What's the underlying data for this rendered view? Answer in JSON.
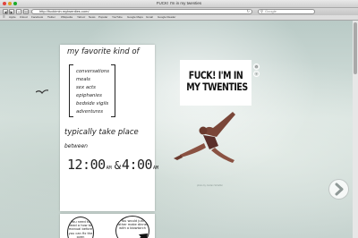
{
  "browser": {
    "window_title": "FUCK! I'm in my twenties",
    "url": "http://fuckimin.mytwenties.com/",
    "search_placeholder": "Google",
    "bookmarks": [
      "Apple",
      "iCloud",
      "Facebook",
      "Twitter",
      "Wikipedia",
      "Yahoo!",
      "News",
      "Popular",
      "YouTube",
      "Google Maps",
      "Gmail",
      "Google Reader"
    ]
  },
  "page": {
    "note": {
      "title": "my favorite kind of",
      "items": [
        "conversations",
        "meals",
        "sex acts",
        "epiphanies",
        "bedside vigils",
        "adventures"
      ],
      "middle": "typically take place",
      "between": "between",
      "time1": "12:00",
      "time1_suffix": "AM",
      "amp": "&",
      "time2": "4:00",
      "time2_suffix": "AM"
    },
    "comic": {
      "bubble1": "You need to read a how to manual before you can fix the oven",
      "bubble2": "You would just rather make dinner with a blowtorch"
    },
    "logo": {
      "line1": "FUCK! I'M IN",
      "line2": "MY TWENTIES"
    },
    "caption": "photo by Jordan Schaffer"
  },
  "icons": {
    "side_top": "gear-icon",
    "side_bottom": "plus-icon",
    "next": "chevron-right-icon"
  },
  "colors": {
    "accent": "#ffffff",
    "ink": "#111111"
  }
}
